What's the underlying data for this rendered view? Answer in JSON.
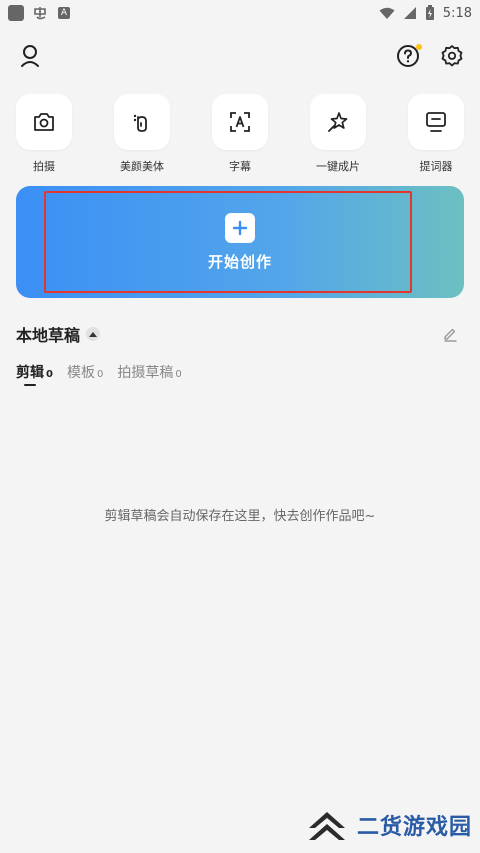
{
  "status_bar": {
    "time": "5:18",
    "badge_letter": "A"
  },
  "quick_actions": [
    {
      "label": "拍摄",
      "icon": "camera-icon"
    },
    {
      "label": "美颜美体",
      "icon": "beauty-icon"
    },
    {
      "label": "字幕",
      "icon": "caption-icon"
    },
    {
      "label": "一键成片",
      "icon": "magic-star-icon"
    },
    {
      "label": "提词器",
      "icon": "teleprompter-icon"
    }
  ],
  "create": {
    "label": "开始创作",
    "icon": "plus-icon"
  },
  "drafts": {
    "title": "本地草稿",
    "tabs": [
      {
        "label": "剪辑",
        "count": "0"
      },
      {
        "label": "模板",
        "count": "0"
      },
      {
        "label": "拍摄草稿",
        "count": "0"
      }
    ],
    "empty_message": "剪辑草稿会自动保存在这里，快去创作作品吧~"
  },
  "watermark": {
    "text": "二货游戏园"
  },
  "colors": {
    "accent_start": "#3b8ff5",
    "accent_end": "#6cc0c1",
    "highlight_red": "#e3362e",
    "notification_dot": "#ffc20e"
  }
}
